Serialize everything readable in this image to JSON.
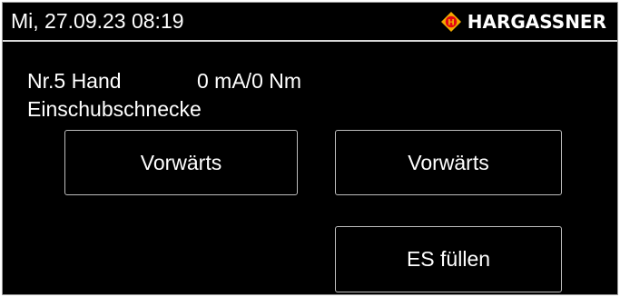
{
  "header": {
    "datetime": "Mi, 27.09.23 08:19",
    "brand": "HARGASSNER",
    "logo_icon": "hargassner-diamond-logo",
    "logo_letter": "H",
    "logo_color": "#f2a900",
    "logo_inner_color": "#e30613"
  },
  "status": {
    "mode": "Nr.5 Hand",
    "load": "0 mA/0 Nm",
    "component": "Einschubschnecke"
  },
  "buttons": {
    "left": "Vorwärts",
    "right": "Vorwärts",
    "fill": "ES füllen"
  }
}
